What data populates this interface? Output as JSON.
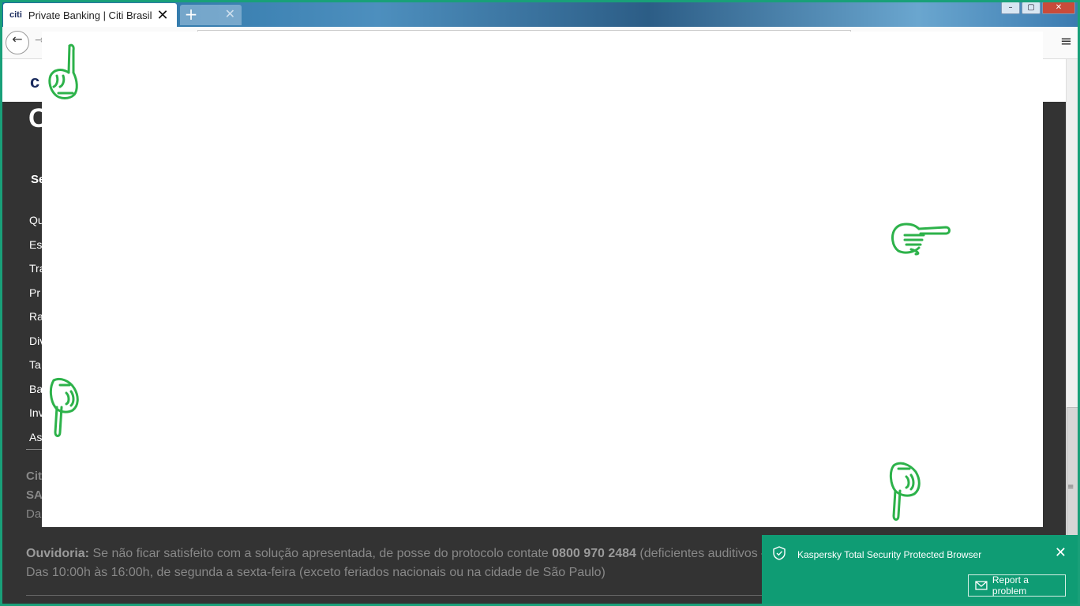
{
  "browser": {
    "tab_favicon_text": "citi",
    "tab_title": "Private Banking | Citi Brasil",
    "tab_close": "✕",
    "new_tab": "+",
    "window_buttons": {
      "minimize": "–",
      "maximize": "▢",
      "close": "✕"
    },
    "back": "←",
    "forward": "→",
    "menu": "≡"
  },
  "page": {
    "logo_text": "c",
    "big_letter": "C",
    "section_title": "Se",
    "links": [
      "Qu",
      "Es",
      "Tra",
      "Pr",
      "Ra",
      "Div",
      "Ta",
      "Ba",
      "Inv",
      "As"
    ],
    "citi_line": "Cit",
    "sa_line": "SA",
    "da_line": "Da",
    "ouvidoria": {
      "label": "Ouvidoria:",
      "text1": " Se não ficar satisfeito com a solução apresentada, de posse do protocolo contate ",
      "phone": "0800 970 2484",
      "text2": " (deficientes auditivos –",
      "line2": "Das 10:00h às 16:00h, de segunda a sexta-feira (exceto feriados nacionais ou na cidade de São Paulo)"
    }
  },
  "scrollbar": {
    "grip": "≡"
  },
  "toast": {
    "title": "Kaspersky Total Security Protected Browser",
    "close": "✕",
    "report_label": "Report a problem"
  },
  "annotations": {
    "hand_color": "#2db24a",
    "icons": [
      "hand-pointing-up-icon",
      "hand-pointing-right-icon",
      "hand-pointing-down-icon",
      "hand-pointing-down-icon"
    ]
  },
  "colors": {
    "accent_green": "#0f9c74",
    "frame_green": "#19a079",
    "footer_bg": "#333333",
    "citi_navy": "#1a2b5e"
  }
}
